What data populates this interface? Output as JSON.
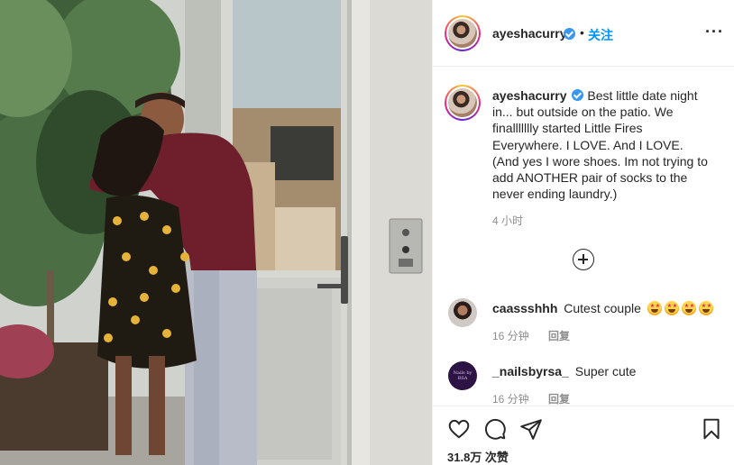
{
  "post": {
    "username": "ayeshacurry",
    "follow_label": "关注",
    "dot": "•",
    "more_icon": "more-horizontal-icon"
  },
  "caption": {
    "username": "ayeshacurry",
    "text": "Best little date night in... but outside on the patio. We finallllllly started Little Fires Everywhere. I LOVE. And I LOVE. (And yes I wore shoes. Im not trying to add ANOTHER pair of socks to the never ending laundry.)",
    "time": "4 小时"
  },
  "comments": [
    {
      "username": "caassshhh",
      "text": "Cutest couple",
      "emoji_count": 4,
      "time": "16 分钟",
      "reply_label": "回复"
    },
    {
      "username": "_nailsbyrsa_",
      "text": "Super cute",
      "avatar_text": "Nails by RSA",
      "time": "16 分钟",
      "reply_label": "回复"
    }
  ],
  "likes": "31.8万 次赞",
  "colors": {
    "link": "#0095f6",
    "verified": "#3897f0",
    "text": "#262626",
    "muted": "#8e8e8e"
  }
}
